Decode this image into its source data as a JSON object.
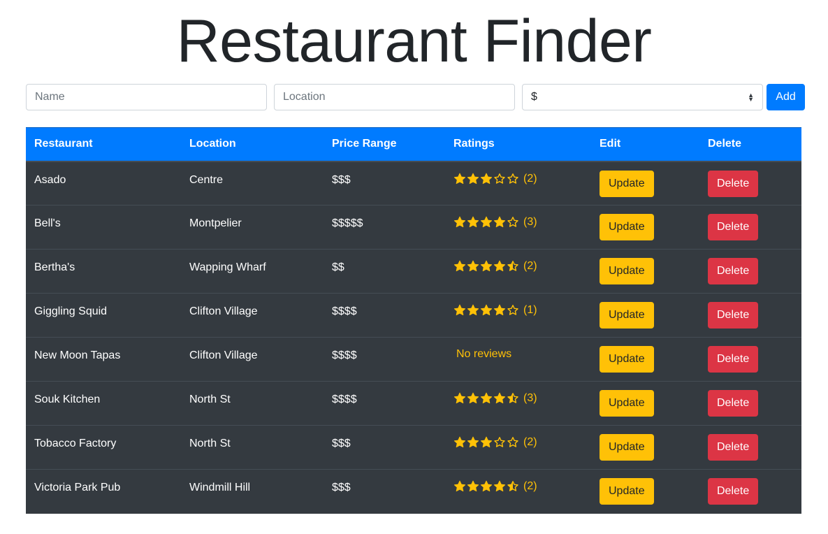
{
  "app": {
    "title": "Restaurant Finder"
  },
  "form": {
    "name_placeholder": "Name",
    "location_placeholder": "Location",
    "price_selected": "$",
    "add_label": "Add"
  },
  "table": {
    "headers": [
      "Restaurant",
      "Location",
      "Price Range",
      "Ratings",
      "Edit",
      "Delete"
    ],
    "update_label": "Update",
    "delete_label": "Delete",
    "no_reviews_label": "No reviews",
    "rows": [
      {
        "name": "Asado",
        "location": "Centre",
        "price": "$$$",
        "rating": 3,
        "count": "(2)"
      },
      {
        "name": "Bell's",
        "location": "Montpelier",
        "price": "$$$$$",
        "rating": 4,
        "count": "(3)"
      },
      {
        "name": "Bertha's",
        "location": "Wapping Wharf",
        "price": "$$",
        "rating": 4.5,
        "count": "(2)"
      },
      {
        "name": "Giggling Squid",
        "location": "Clifton Village",
        "price": "$$$$",
        "rating": 4,
        "count": "(1)"
      },
      {
        "name": "New Moon Tapas",
        "location": "Clifton Village",
        "price": "$$$$",
        "rating": null,
        "count": null
      },
      {
        "name": "Souk Kitchen",
        "location": "North St",
        "price": "$$$$",
        "rating": 4.5,
        "count": "(3)"
      },
      {
        "name": "Tobacco Factory",
        "location": "North St",
        "price": "$$$",
        "rating": 3,
        "count": "(2)"
      },
      {
        "name": "Victoria Park Pub",
        "location": "Windmill Hill",
        "price": "$$$",
        "rating": 4.5,
        "count": "(2)"
      }
    ]
  },
  "colors": {
    "primary": "#007bff",
    "warning": "#ffc107",
    "danger": "#dc3545",
    "dark": "#343a40"
  }
}
